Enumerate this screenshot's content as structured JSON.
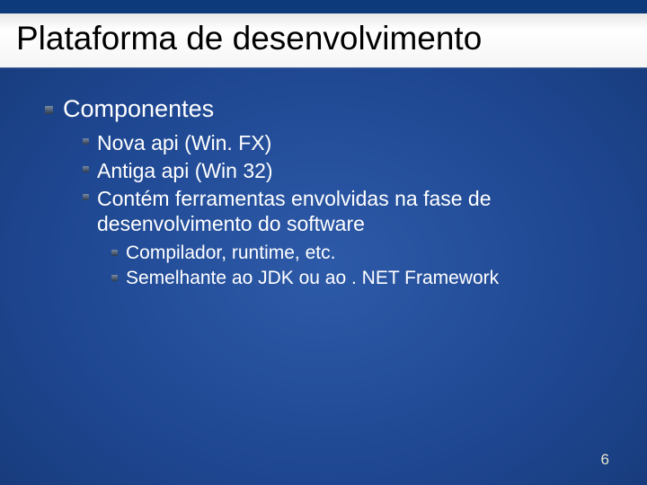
{
  "title": "Plataforma de desenvolvimento",
  "lvl1": "Componentes",
  "lvl2": {
    "a": "Nova api (Win. FX)",
    "b": "Antiga api (Win 32)",
    "c": "Contém ferramentas envolvidas na fase de desenvolvimento do software"
  },
  "lvl3": {
    "a": "Compilador, runtime, etc.",
    "b": "Semelhante ao JDK ou ao . NET Framework"
  },
  "page_number": "6"
}
